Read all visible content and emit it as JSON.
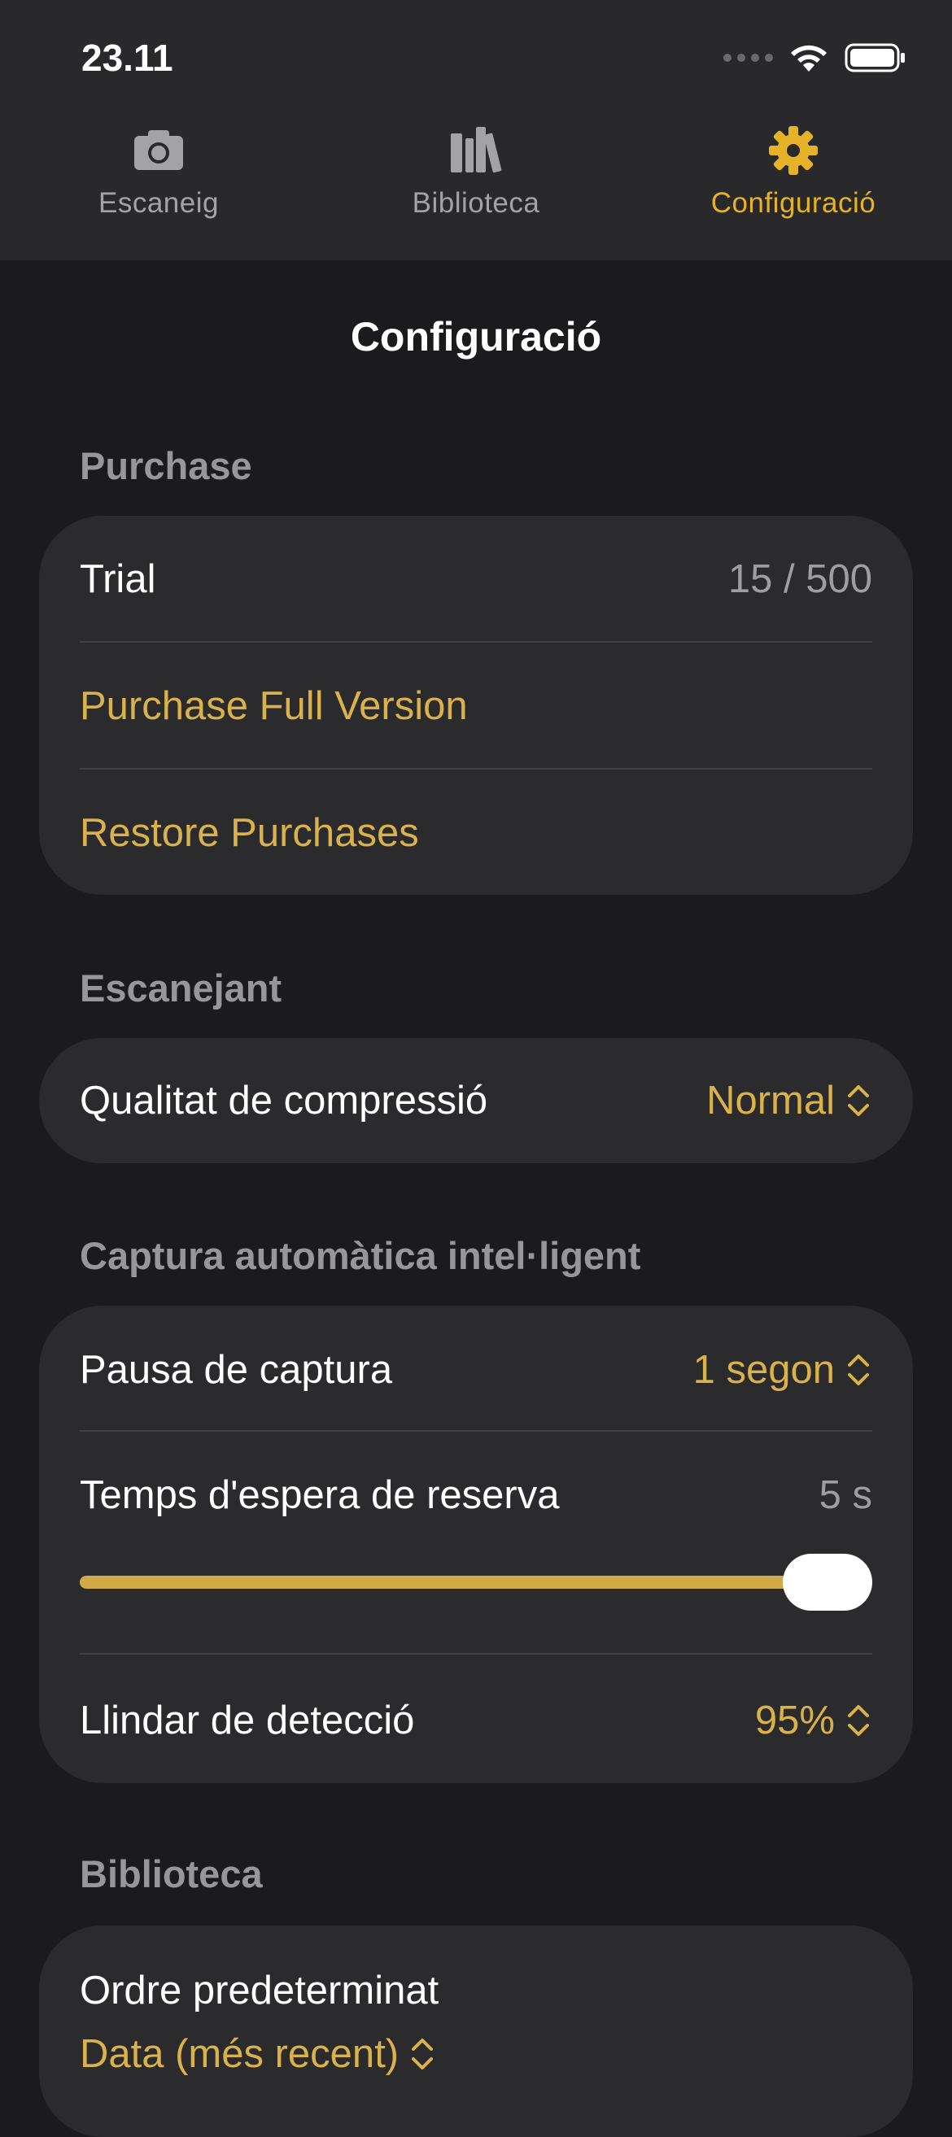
{
  "status_bar": {
    "time": "23.11"
  },
  "tabs": [
    {
      "label": "Escaneig",
      "icon": "camera-icon",
      "active": false
    },
    {
      "label": "Biblioteca",
      "icon": "library-icon",
      "active": false
    },
    {
      "label": "Configuració",
      "icon": "gear-icon",
      "active": true
    }
  ],
  "page": {
    "title": "Configuració"
  },
  "purchase": {
    "header": "Purchase",
    "trial_label": "Trial",
    "trial_value": "15 / 500",
    "purchase_full": "Purchase Full Version",
    "restore": "Restore Purchases"
  },
  "scanning": {
    "header": "Escanejant",
    "compression_label": "Qualitat de compressió",
    "compression_value": "Normal"
  },
  "autocapture": {
    "header": "Captura automàtica intel·ligent",
    "pause_label": "Pausa de captura",
    "pause_value": "1 segon",
    "timeout_label": "Temps d'espera de reserva",
    "timeout_value": "5 s",
    "timeout_slider_fraction": 1.0,
    "threshold_label": "Llindar de detecció",
    "threshold_value": "95%"
  },
  "library": {
    "header": "Biblioteca",
    "default_order_label": "Ordre predeterminat",
    "default_order_value": "Data (més recent)"
  },
  "colors": {
    "accent": "#e6b227",
    "background": "#1b1b1d",
    "card": "#2b2b2d"
  }
}
